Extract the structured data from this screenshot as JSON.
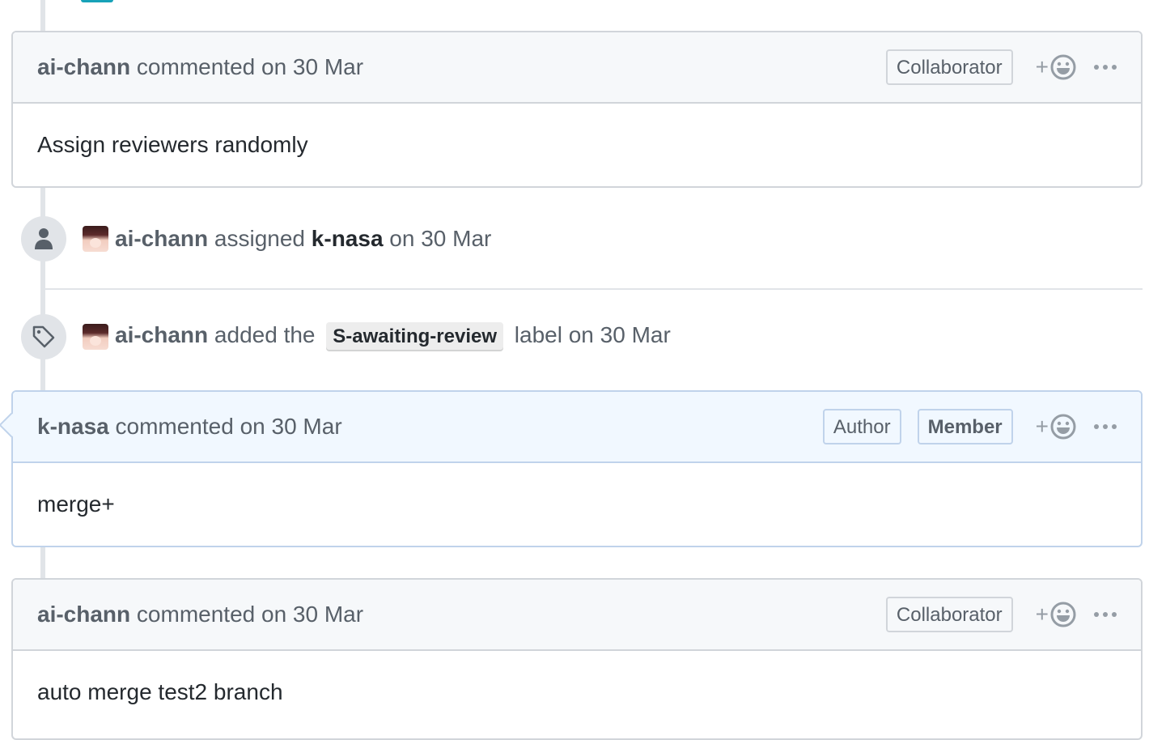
{
  "comments": [
    {
      "author": "ai-chann",
      "action": "commented",
      "date": "on 30 Mar",
      "badges": [
        "Collaborator"
      ],
      "body": "Assign reviewers randomly"
    },
    {
      "author": "k-nasa",
      "action": "commented",
      "date": "on 30 Mar",
      "badges": [
        "Author",
        "Member"
      ],
      "body": "merge+"
    },
    {
      "author": "ai-chann",
      "action": "commented",
      "date": "on 30 Mar",
      "badges": [
        "Collaborator"
      ],
      "body": "auto merge test2 branch"
    }
  ],
  "events": {
    "assigned": {
      "actor": "ai-chann",
      "verb": "assigned",
      "target": "k-nasa",
      "date": "on 30 Mar"
    },
    "labeled": {
      "actor": "ai-chann",
      "verb": "added the",
      "label": "S-awaiting-review",
      "suffix": "label on 30 Mar"
    }
  },
  "icons": {
    "reaction": "smiley-icon",
    "more": "kebab-horizontal-icon",
    "assigned": "person-icon",
    "labeled": "tag-icon"
  },
  "colors": {
    "author_header_bg": "#f1f8ff",
    "author_border": "#c0d3eb",
    "header_bg": "#f6f8fa",
    "border": "#d1d5da",
    "muted_text": "#586069"
  }
}
